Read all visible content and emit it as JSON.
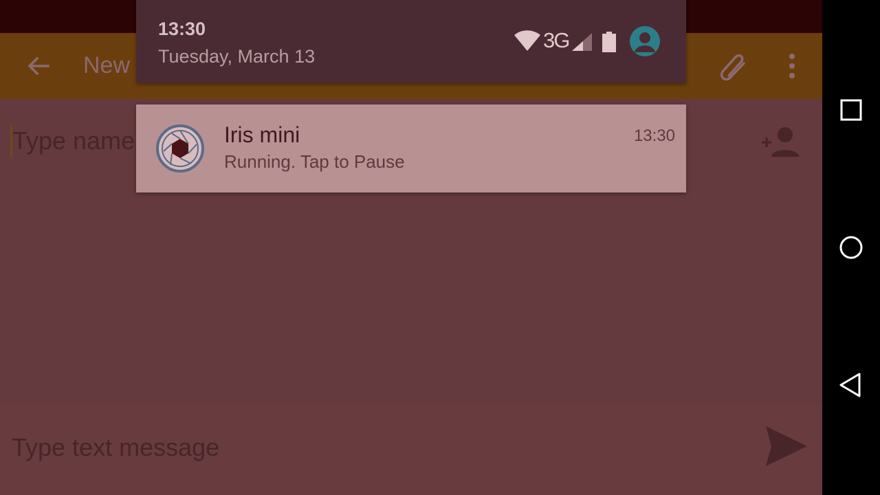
{
  "app": {
    "toolbar_title": "New",
    "recipient_placeholder": "Type name",
    "compose_placeholder": "Type text message"
  },
  "shade": {
    "time": "13:30",
    "date": "Tuesday, March 13",
    "network_type": "3G"
  },
  "notification": {
    "title": "Iris mini",
    "text": "Running. Tap to Pause",
    "time": "13:30"
  },
  "icons": {
    "toolbar": [
      "back-arrow-icon",
      "paperclip-icon",
      "more-vert-icon"
    ],
    "recipient": [
      "add-contact-icon"
    ],
    "compose": [
      "send-icon"
    ],
    "status": [
      "wifi-icon",
      "signal-icon",
      "battery-icon",
      "user-avatar-icon"
    ],
    "nav": [
      "recents-icon",
      "home-icon",
      "back-icon"
    ]
  },
  "colors": {
    "screen_dim": "#643a3e",
    "status_bar": "#2b0405",
    "toolbar": "#6b3e0d",
    "shade_header": "#4b2b33",
    "notification_card": "#b89193",
    "avatar": "#2b7f88",
    "nav_bar": "#000000"
  }
}
